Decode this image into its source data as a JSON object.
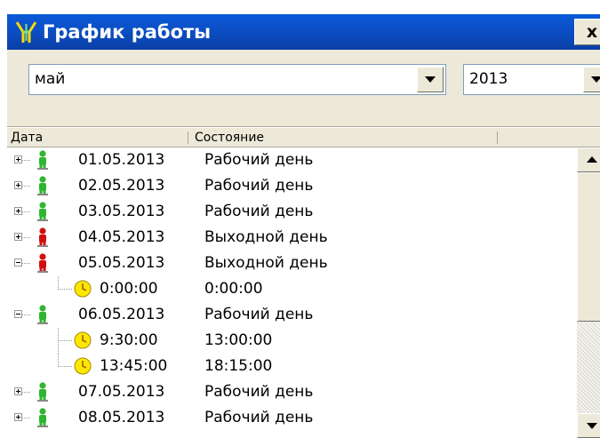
{
  "window": {
    "title": "График работы",
    "close_label": "x"
  },
  "filters": {
    "month": "май",
    "year": "2013"
  },
  "table": {
    "columns": [
      "Дата",
      "Состояние"
    ],
    "rows": [
      {
        "kind": "day",
        "icon": "green-person-icon",
        "expander": "plus",
        "date": "01.05.2013",
        "state": "Рабочий день"
      },
      {
        "kind": "day",
        "icon": "green-person-icon",
        "expander": "plus",
        "date": "02.05.2013",
        "state": "Рабочий день"
      },
      {
        "kind": "day",
        "icon": "green-person-icon",
        "expander": "plus",
        "date": "03.05.2013",
        "state": "Рабочий день"
      },
      {
        "kind": "day",
        "icon": "red-person-icon",
        "expander": "plus",
        "date": "04.05.2013",
        "state": "Выходной день"
      },
      {
        "kind": "day",
        "icon": "red-person-icon",
        "expander": "minus",
        "date": "05.05.2013",
        "state": "Выходной день"
      },
      {
        "kind": "interval",
        "icon": "clock-icon",
        "start": "0:00:00",
        "end": "0:00:00"
      },
      {
        "kind": "day",
        "icon": "green-person-icon",
        "expander": "minus",
        "date": "06.05.2013",
        "state": "Рабочий день"
      },
      {
        "kind": "interval",
        "icon": "clock-icon",
        "start": "9:30:00",
        "end": "13:00:00"
      },
      {
        "kind": "interval",
        "icon": "clock-icon",
        "start": "13:45:00",
        "end": "18:15:00"
      },
      {
        "kind": "day",
        "icon": "green-person-icon",
        "expander": "plus",
        "date": "07.05.2013",
        "state": "Рабочий день"
      },
      {
        "kind": "day",
        "icon": "green-person-icon",
        "expander": "plus",
        "date": "08.05.2013",
        "state": "Рабочий день"
      }
    ]
  },
  "colors": {
    "titlebar": "#0a50c8",
    "workday_icon": "#2fb52f",
    "dayoff_icon": "#d01010",
    "clock_icon": "#ffe800"
  }
}
